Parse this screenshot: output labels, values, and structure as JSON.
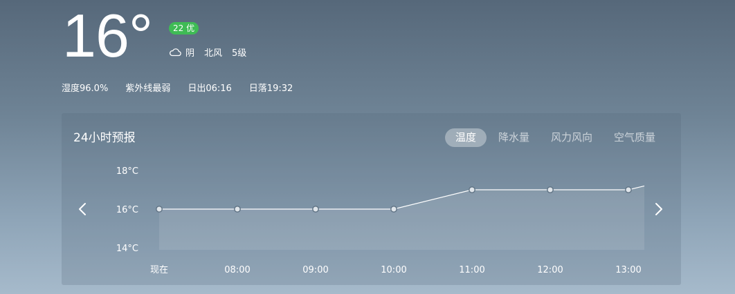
{
  "current": {
    "temperature": "16°",
    "aqi_badge": "22 优",
    "condition": "阴",
    "wind_direction": "北风",
    "wind_level": "5级",
    "condition_icon": "cloud-icon"
  },
  "details": {
    "humidity": "湿度96.0%",
    "uv": "紫外线最弱",
    "sunrise": "日出06:16",
    "sunset": "日落19:32"
  },
  "forecast": {
    "title": "24小时预报",
    "tabs": [
      {
        "label": "温度",
        "active": true
      },
      {
        "label": "降水量",
        "active": false
      },
      {
        "label": "风力风向",
        "active": false
      },
      {
        "label": "空气质量",
        "active": false
      }
    ],
    "prev_icon": "chevron-left-icon",
    "next_icon": "chevron-right-icon"
  },
  "chart_data": {
    "type": "area",
    "title": "",
    "xlabel": "",
    "ylabel": "",
    "categories": [
      "现在",
      "08:00",
      "09:00",
      "10:00",
      "11:00",
      "12:00",
      "13:00"
    ],
    "series": [
      {
        "values": [
          16,
          16,
          16,
          16,
          17,
          17,
          17
        ]
      }
    ],
    "trailing_value": 17.2,
    "yticks": [
      18,
      16,
      14
    ],
    "ytick_labels": [
      "18°C",
      "16°C",
      "14°C"
    ],
    "ylim": [
      14,
      18
    ],
    "grid": false,
    "line_color": "#ffffff"
  }
}
